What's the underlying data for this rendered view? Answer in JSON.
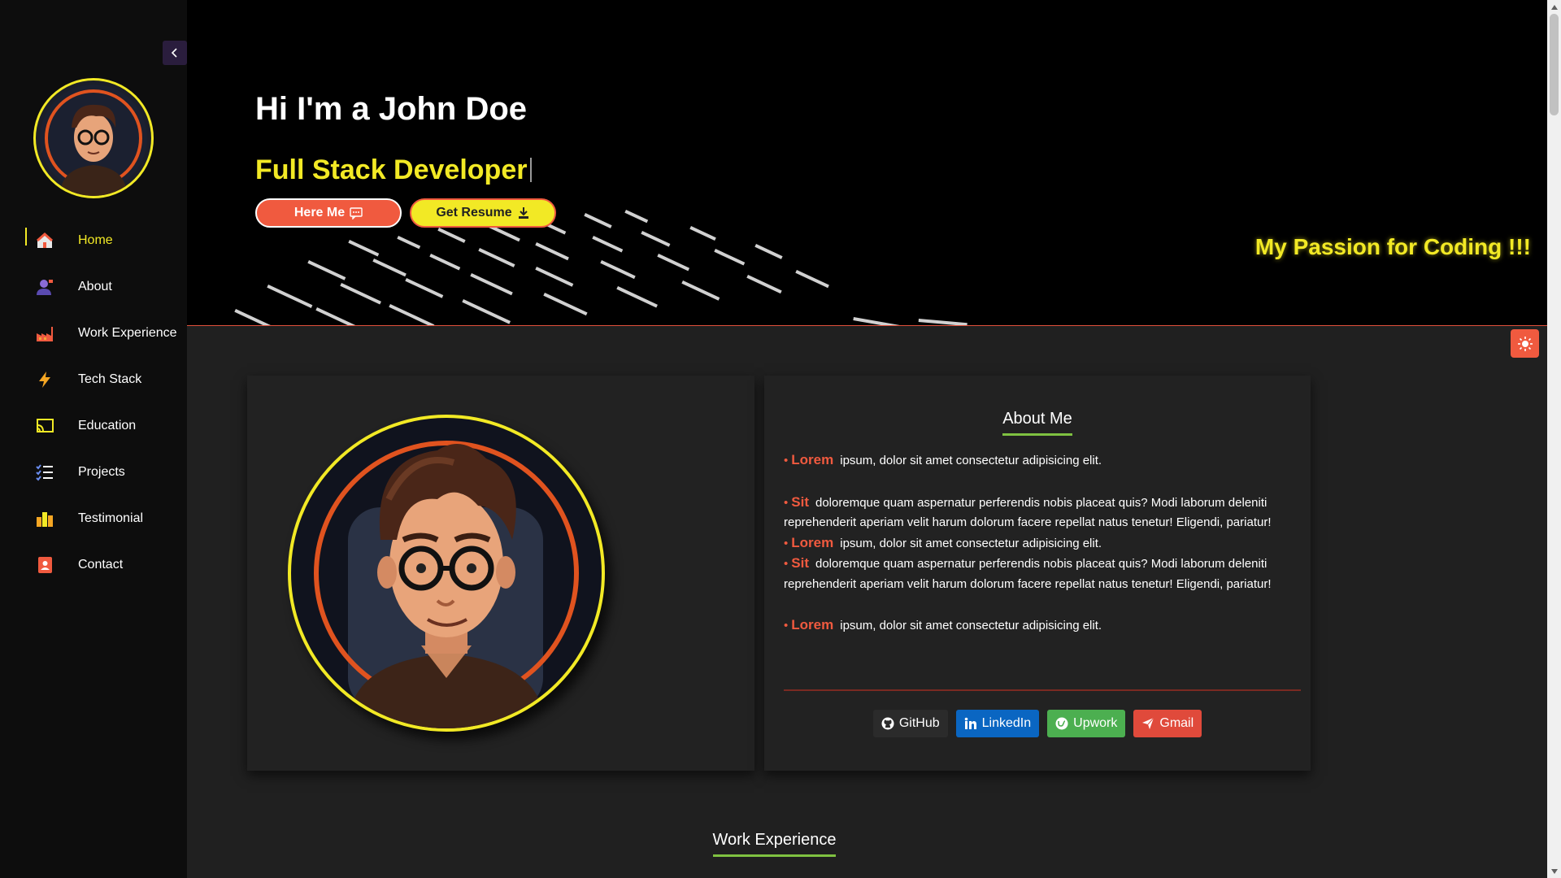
{
  "sidebar": {
    "items": [
      {
        "label": "Home",
        "icon": "home-icon",
        "active": true
      },
      {
        "label": "About",
        "icon": "user-icon"
      },
      {
        "label": "Work Experience",
        "icon": "factory-icon"
      },
      {
        "label": "Tech Stack",
        "icon": "lightning-icon"
      },
      {
        "label": "Education",
        "icon": "cast-icon"
      },
      {
        "label": "Projects",
        "icon": "checklist-icon"
      },
      {
        "label": "Testimonial",
        "icon": "bar-chart-icon"
      },
      {
        "label": "Contact",
        "icon": "contact-book-icon"
      }
    ]
  },
  "hero": {
    "title": "Hi I'm a John Doe",
    "subtitle": "Full Stack Developer",
    "hire_label": "Here Me",
    "resume_label": "Get Resume",
    "passion": "My Passion for Coding !!!"
  },
  "about": {
    "heading": "About Me",
    "paragraphs": [
      {
        "kw": "Lorem",
        "text": "ipsum, dolor sit amet consectetur adipisicing elit."
      },
      {
        "kw": "Sit",
        "text": "doloremque quam aspernatur perferendis nobis placeat quis? Modi laborum deleniti reprehenderit aperiam velit harum dolorum facere repellat natus tenetur! Eligendi, pariatur!"
      },
      {
        "kw": "Lorem",
        "text": "ipsum, dolor sit amet consectetur adipisicing elit."
      },
      {
        "kw": "Sit",
        "text": "doloremque quam aspernatur perferendis nobis placeat quis? Modi laborum deleniti reprehenderit aperiam velit harum dolorum facere repellat natus tenetur! Eligendi, pariatur!"
      },
      {
        "kw": "Lorem",
        "text": "ipsum, dolor sit amet consectetur adipisicing elit."
      }
    ],
    "socials": {
      "github": "GitHub",
      "linkedin": "LinkedIn",
      "upwork": "Upwork",
      "gmail": "Gmail"
    }
  },
  "work": {
    "heading": "Work Experience"
  },
  "colors": {
    "accent_yellow": "#f2e925",
    "accent_orange": "#f05a3f",
    "underline_green": "#7fc241"
  }
}
